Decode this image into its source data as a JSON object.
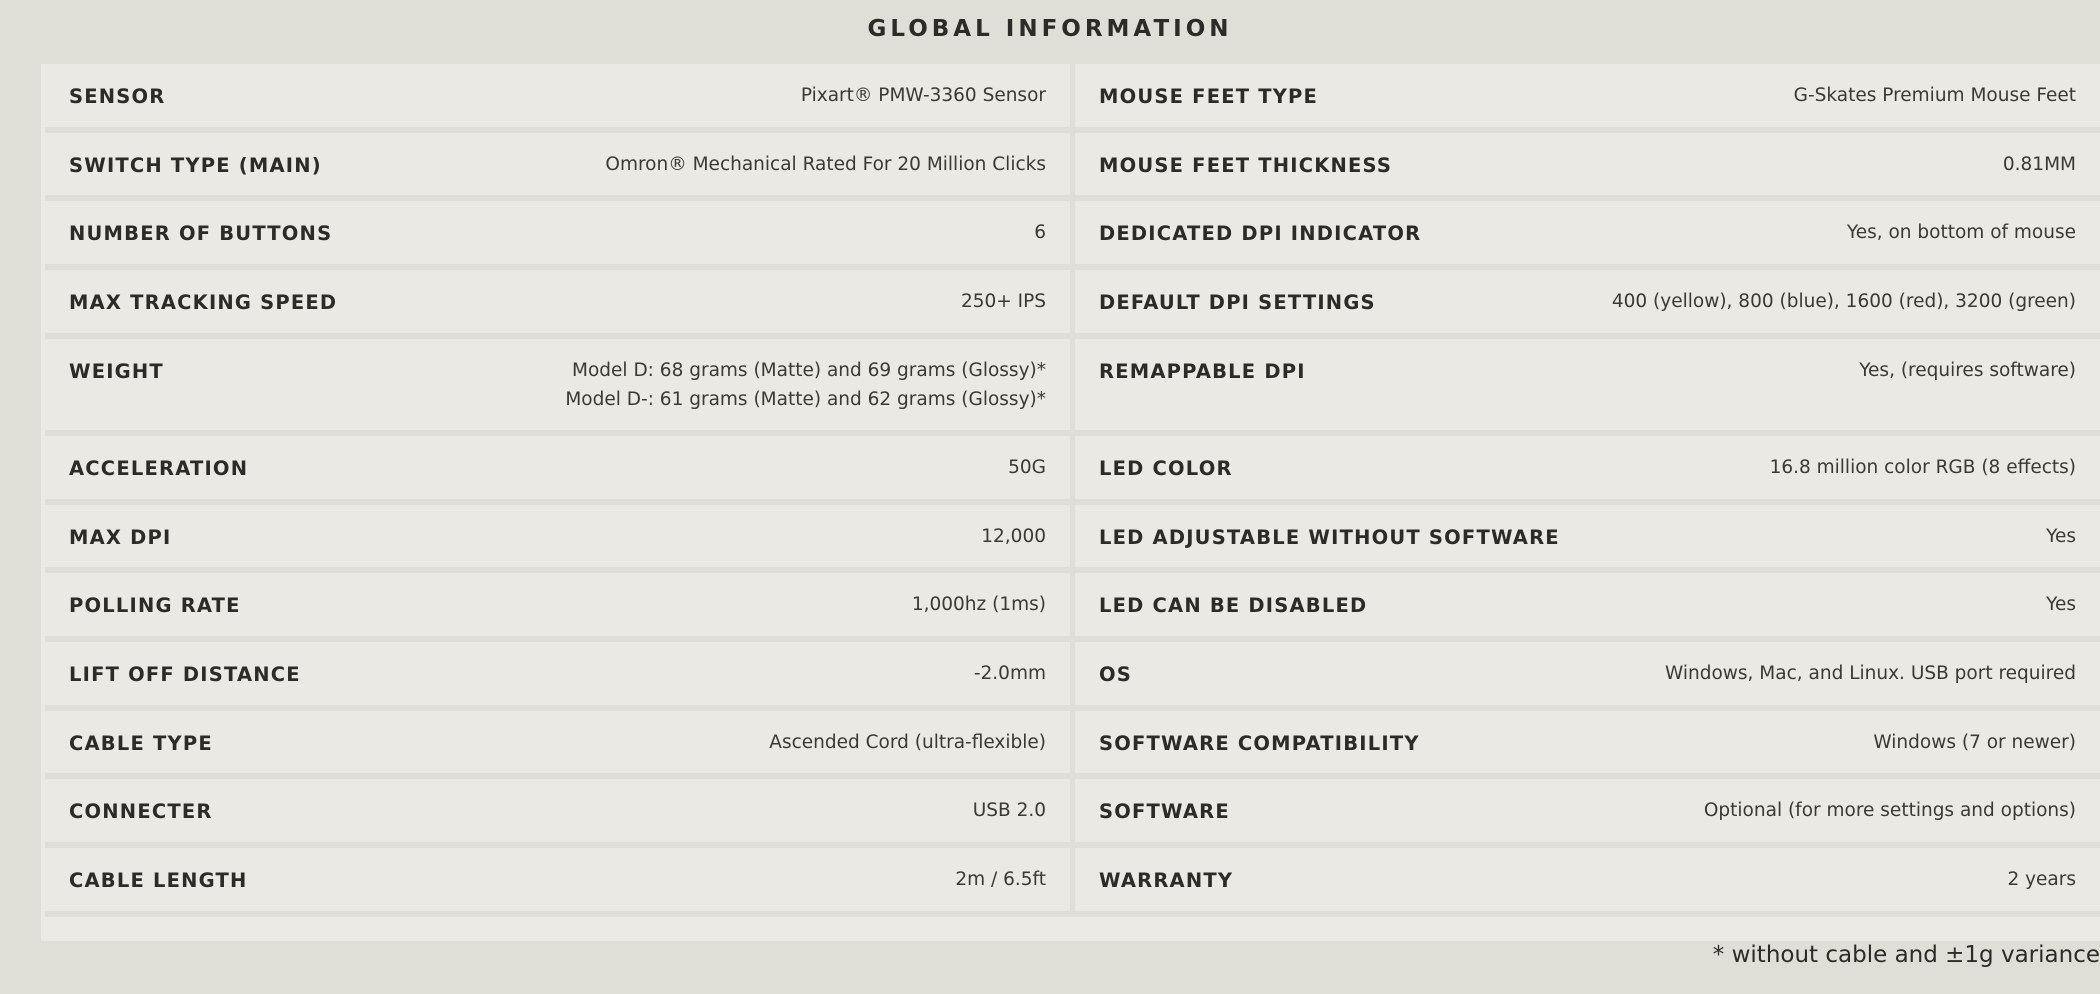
{
  "title": "GLOBAL INFORMATION",
  "left_specs": [
    {
      "label": "SENSOR",
      "value": "Pixart® PMW-3360 Sensor"
    },
    {
      "label": "SWITCH TYPE (MAIN)",
      "value": "Omron® Mechanical Rated For 20 Million Clicks"
    },
    {
      "label": "NUMBER OF BUTTONS",
      "value": "6"
    },
    {
      "label": "MAX TRACKING SPEED",
      "value": "250+ IPS"
    },
    {
      "label": "WEIGHT",
      "value": "Model D: 68 grams (Matte) and 69 grams (Glossy)*",
      "value2": "Model D-: 61 grams (Matte) and 62 grams (Glossy)*"
    },
    {
      "label": "ACCELERATION",
      "value": "50G"
    },
    {
      "label": "MAX DPI",
      "value": "12,000"
    },
    {
      "label": "POLLING RATE",
      "value": "1,000hz (1ms)"
    },
    {
      "label": "LIFT OFF DISTANCE",
      "value": "-2.0mm"
    },
    {
      "label": "CABLE TYPE",
      "value": "Ascended Cord (ultra-flexible)"
    },
    {
      "label": "CONNECTER",
      "value": "USB 2.0"
    },
    {
      "label": "CABLE LENGTH",
      "value": "2m / 6.5ft"
    }
  ],
  "right_specs": [
    {
      "label": "MOUSE FEET TYPE",
      "value": "G-Skates Premium Mouse Feet"
    },
    {
      "label": "MOUSE FEET THICKNESS",
      "value": "0.81MM"
    },
    {
      "label": "DEDICATED DPI INDICATOR",
      "value": "Yes, on bottom of mouse"
    },
    {
      "label": "DEFAULT DPI SETTINGS",
      "value": "400 (yellow), 800 (blue), 1600 (red), 3200 (green)"
    },
    {
      "label": "REMAPPABLE DPI",
      "value": "Yes, (requires software)"
    },
    {
      "label": "LED COLOR",
      "value": "16.8 million color RGB (8 effects)"
    },
    {
      "label": "LED ADJUSTABLE WITHOUT SOFTWARE",
      "value": "Yes"
    },
    {
      "label": "LED CAN BE DISABLED",
      "value": "Yes"
    },
    {
      "label": "OS",
      "value": "Windows, Mac, and Linux. USB port required"
    },
    {
      "label": "SOFTWARE COMPATIBILITY",
      "value": "Windows (7 or newer)"
    },
    {
      "label": "SOFTWARE",
      "value": "Optional (for more settings and options)"
    },
    {
      "label": "WARRANTY",
      "value": "2 years"
    }
  ],
  "footnote": "* without cable and ±1g variance"
}
